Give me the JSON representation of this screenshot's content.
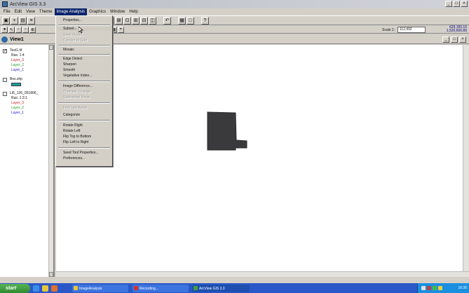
{
  "window": {
    "title": "ArcView GIS 3.3",
    "controls": [
      "_",
      "□",
      "×"
    ]
  },
  "menu": [
    "File",
    "Edit",
    "View",
    "Theme",
    "Image Analysis",
    "Graphics",
    "Window",
    "Help"
  ],
  "active_menu": "Image Analysis",
  "scale": {
    "label": "Scale 1:",
    "value": "112,992"
  },
  "coords": {
    "x": "629,150.16",
    "y": "1,520,600.89"
  },
  "view": {
    "title": "View1"
  },
  "toc": {
    "themes": [
      {
        "name": "Test1.tif",
        "checked": true,
        "lines": [
          "Ras: 1:4",
          "Layer_3",
          "Layer_2",
          "Layer_1"
        ]
      },
      {
        "name": "Box.shp",
        "checked": false,
        "lines": []
      },
      {
        "name": "Lt5_126_051806_",
        "checked": false,
        "lines": [
          "Ras: 1:3:1",
          "Layer_3",
          "Layer_2",
          "Layer_1"
        ]
      }
    ],
    "layer_colors": {
      "Layer_3": "#d02020",
      "Layer_2": "#20a020",
      "Layer_1": "#2020d0"
    }
  },
  "dropdown": {
    "items": [
      {
        "label": "Properties...",
        "enabled": true
      },
      {
        "sep": true
      },
      {
        "label": "Subset...",
        "enabled": true,
        "highlight": true
      },
      {
        "label": "Seed Model...",
        "enabled": false
      },
      {
        "label": "Convert to Grid",
        "enabled": false
      },
      {
        "sep": true
      },
      {
        "label": "Mosaic",
        "enabled": true
      },
      {
        "sep": true
      },
      {
        "label": "Edge Detect",
        "enabled": true
      },
      {
        "label": "Sharpen",
        "enabled": true
      },
      {
        "label": "Smooth",
        "enabled": true
      },
      {
        "label": "Vegetative Index...",
        "enabled": true
      },
      {
        "sep": true
      },
      {
        "label": "Image Difference...",
        "enabled": true
      },
      {
        "label": "Thematic Change",
        "enabled": false
      },
      {
        "label": "Subtracted Areas...",
        "enabled": false
      },
      {
        "sep": true
      },
      {
        "label": "Find Like Areas",
        "enabled": false
      },
      {
        "label": "Categorize",
        "enabled": true
      },
      {
        "sep": true
      },
      {
        "label": "Rotate Right",
        "enabled": true
      },
      {
        "label": "Rotate Left",
        "enabled": true
      },
      {
        "label": "Flip Top to Bottom",
        "enabled": true
      },
      {
        "label": "Flip Left to Right",
        "enabled": true
      },
      {
        "sep": true
      },
      {
        "label": "Seed Tool Properties...",
        "enabled": true
      },
      {
        "label": "Preferences...",
        "enabled": true
      }
    ]
  },
  "taskbar": {
    "start": "start",
    "tasks": [
      "ImageAnalysis",
      "Recording...",
      "ArcView GIS 3.3"
    ],
    "clock": "16:36"
  },
  "colors": {
    "selection": "#0a246a",
    "map_shape": "#3a3a3c"
  }
}
